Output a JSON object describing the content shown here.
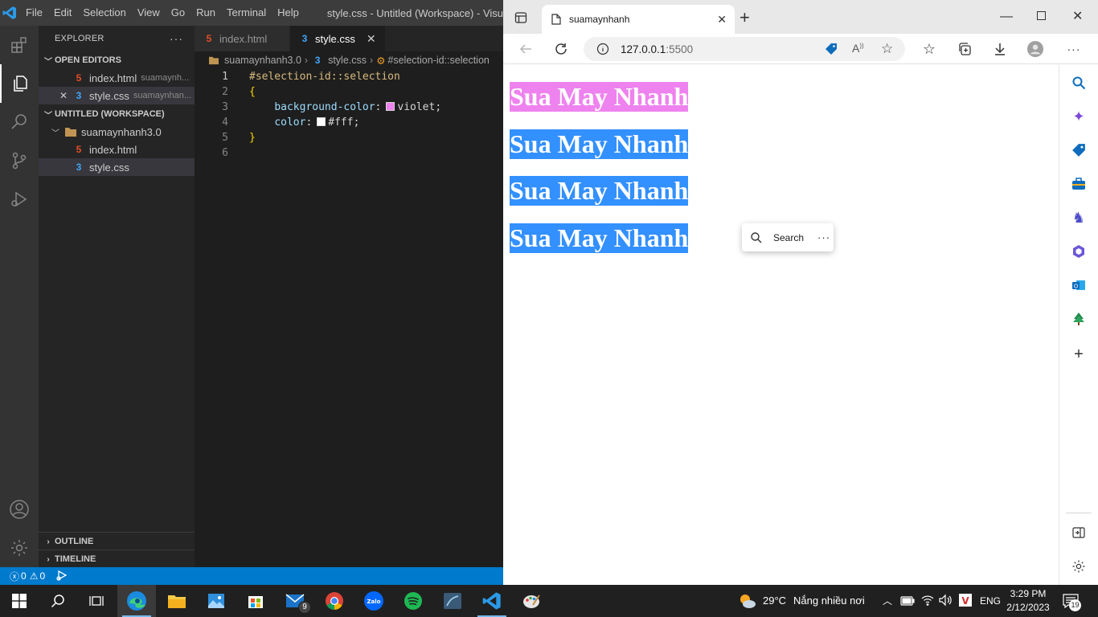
{
  "vscode": {
    "window_title": "style.css - Untitled (Workspace) - Visu",
    "menu": [
      "File",
      "Edit",
      "Selection",
      "View",
      "Go",
      "Run",
      "Terminal",
      "Help"
    ],
    "explorer": {
      "title": "EXPLORER",
      "more": "···",
      "open_editors_header": "OPEN EDITORS",
      "open_editors": [
        {
          "name": "index.html",
          "desc": "suamaynh...",
          "type": "html"
        },
        {
          "name": "style.css",
          "desc": "suamaynhan...",
          "type": "css",
          "close": "✕"
        }
      ],
      "workspace_header": "UNTITLED (WORKSPACE)",
      "folder": "suamaynhanh3.0",
      "files": [
        {
          "name": "index.html",
          "type": "html"
        },
        {
          "name": "style.css",
          "type": "css"
        }
      ],
      "outline_header": "OUTLINE",
      "timeline_header": "TIMELINE"
    },
    "tabs": [
      {
        "label": "index.html",
        "type": "html"
      },
      {
        "label": "style.css",
        "type": "css",
        "close": "✕"
      }
    ],
    "breadcrumb": [
      "suamaynhanh3.0",
      "style.css",
      "#selection-id::selection"
    ],
    "code": {
      "line_numbers": [
        "1",
        "2",
        "3",
        "4",
        "5",
        "6"
      ],
      "selector": "#selection-id::selection",
      "open_brace": "{",
      "prop1": "background-color",
      "val1": "violet;",
      "prop2": "color",
      "val2": "#fff;",
      "close_brace": "}",
      "swatch1": "#ee82ee",
      "swatch2": "#ffffff"
    },
    "status": {
      "errors": "0",
      "warnings": "0"
    }
  },
  "edge": {
    "tab_title": "suamaynhanh",
    "tab_close": "✕",
    "new_tab": "+",
    "address_host": "127.0.0.1",
    "address_port": ":5500",
    "page_lines": [
      "Sua May Nhanh",
      "Sua May Nhanh",
      "Sua May Nhanh",
      "Sua May Nhanh"
    ],
    "page_colors": [
      "#ee82ee",
      "#3390ff",
      "#3390ff",
      "#3390ff"
    ],
    "search_popup": {
      "label": "Search",
      "more": "···"
    }
  },
  "taskbar": {
    "weather_temp": "29°C",
    "weather_text": "Nắng nhiều nơi",
    "language": "ENG",
    "time": "3:29 PM",
    "date": "2/12/2023",
    "mail_badge": "9",
    "notif_badge": "19"
  },
  "colors": {
    "vscode_status": "#007acc",
    "edge_selection": "#3390ff",
    "violet": "#ee82ee"
  }
}
